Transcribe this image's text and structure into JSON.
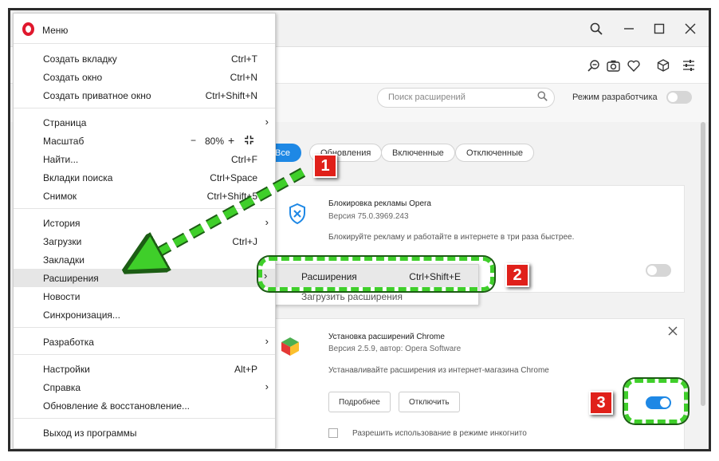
{
  "menu": {
    "title": "Меню",
    "items": [
      {
        "label": "Создать вкладку",
        "shortcut": "Ctrl+T"
      },
      {
        "label": "Создать окно",
        "shortcut": "Ctrl+N"
      },
      {
        "label": "Создать приватное окно",
        "shortcut": "Ctrl+Shift+N"
      },
      {
        "label": "Страница",
        "shortcut": ""
      },
      {
        "label": "Масштаб",
        "shortcut": ""
      },
      {
        "label": "Найти...",
        "shortcut": "Ctrl+F"
      },
      {
        "label": "Вкладки поиска",
        "shortcut": "Ctrl+Space"
      },
      {
        "label": "Снимок",
        "shortcut": "Ctrl+Shift+5"
      },
      {
        "label": "История",
        "shortcut": ""
      },
      {
        "label": "Загрузки",
        "shortcut": "Ctrl+J"
      },
      {
        "label": "Закладки",
        "shortcut": ""
      },
      {
        "label": "Расширения",
        "shortcut": ""
      },
      {
        "label": "Новости",
        "shortcut": ""
      },
      {
        "label": "Синхронизация...",
        "shortcut": ""
      },
      {
        "label": "Разработка",
        "shortcut": ""
      },
      {
        "label": "Настройки",
        "shortcut": "Alt+P"
      },
      {
        "label": "Справка",
        "shortcut": ""
      },
      {
        "label": "Обновление & восстановление...",
        "shortcut": ""
      },
      {
        "label": "Выход из программы",
        "shortcut": ""
      }
    ],
    "zoom": {
      "minus": "−",
      "value": "80%",
      "plus": "+"
    }
  },
  "submenu": {
    "item_label": "Расширения",
    "item_shortcut": "Ctrl+Shift+E",
    "second_item": "Загрузить расширения"
  },
  "extensions_page": {
    "search_placeholder": "Поиск расширений",
    "dev_mode_label": "Режим разработчика",
    "dev_mode_on": false,
    "filters": [
      "Все",
      "Обновления",
      "Включенные",
      "Отключенные"
    ],
    "active_filter": "Все",
    "cards": [
      {
        "title": "Блокировка рекламы Opera",
        "version": "Версия 75.0.3969.243",
        "description": "Блокируйте рекламу и работайте в интернете в три раза быстрее.",
        "enabled": false
      },
      {
        "title": "Установка расширений Chrome",
        "version": "Версия 2.5.9, автор: Opera Software",
        "description": "Устанавливайте расширения из интернет-магазина Chrome",
        "details_button": "Подробнее",
        "disable_button": "Отключить",
        "incognito_label": "Разрешить использование в режиме инкогнито",
        "enabled": true
      }
    ]
  },
  "annotations": [
    "1",
    "2",
    "3"
  ],
  "colors": {
    "accent": "#1e88e5",
    "opera_red": "#e0182d",
    "badge": "#e0201a",
    "highlight": "#3fcf2a"
  }
}
